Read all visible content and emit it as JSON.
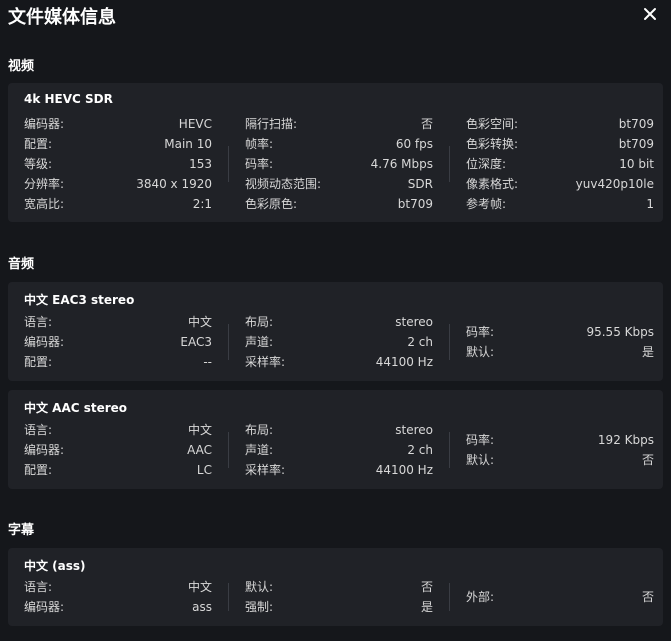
{
  "dialog": {
    "title": "文件媒体信息"
  },
  "video": {
    "section_title": "视频",
    "card": {
      "title": "4k HEVC SDR",
      "col1": [
        {
          "k": "编码器:",
          "v": "HEVC"
        },
        {
          "k": "配置:",
          "v": "Main 10"
        },
        {
          "k": "等级:",
          "v": "153"
        },
        {
          "k": "分辨率:",
          "v": "3840 x 1920"
        },
        {
          "k": "宽高比:",
          "v": "2:1"
        }
      ],
      "col2": [
        {
          "k": "隔行扫描:",
          "v": "否"
        },
        {
          "k": "帧率:",
          "v": "60 fps"
        },
        {
          "k": "码率:",
          "v": "4.76 Mbps"
        },
        {
          "k": "视频动态范围:",
          "v": "SDR"
        },
        {
          "k": "色彩原色:",
          "v": "bt709"
        }
      ],
      "col3": [
        {
          "k": "色彩空间:",
          "v": "bt709"
        },
        {
          "k": "色彩转换:",
          "v": "bt709"
        },
        {
          "k": "位深度:",
          "v": "10 bit"
        },
        {
          "k": "像素格式:",
          "v": "yuv420p10le"
        },
        {
          "k": "参考帧:",
          "v": "1"
        }
      ]
    }
  },
  "audio": {
    "section_title": "音频",
    "cards": [
      {
        "title": "中文 EAC3 stereo",
        "col1": [
          {
            "k": "语言:",
            "v": "中文"
          },
          {
            "k": "编码器:",
            "v": "EAC3"
          },
          {
            "k": "配置:",
            "v": "--"
          }
        ],
        "col2": [
          {
            "k": "布局:",
            "v": "stereo"
          },
          {
            "k": "声道:",
            "v": "2 ch"
          },
          {
            "k": "采样率:",
            "v": "44100 Hz"
          }
        ],
        "col3": [
          {
            "k": "码率:",
            "v": "95.55 Kbps"
          },
          {
            "k": "默认:",
            "v": "是"
          }
        ]
      },
      {
        "title": "中文 AAC stereo",
        "col1": [
          {
            "k": "语言:",
            "v": "中文"
          },
          {
            "k": "编码器:",
            "v": "AAC"
          },
          {
            "k": "配置:",
            "v": "LC"
          }
        ],
        "col2": [
          {
            "k": "布局:",
            "v": "stereo"
          },
          {
            "k": "声道:",
            "v": "2 ch"
          },
          {
            "k": "采样率:",
            "v": "44100 Hz"
          }
        ],
        "col3": [
          {
            "k": "码率:",
            "v": "192 Kbps"
          },
          {
            "k": "默认:",
            "v": "否"
          }
        ]
      }
    ]
  },
  "subtitle": {
    "section_title": "字幕",
    "card": {
      "title": "中文  (ass)",
      "col1": [
        {
          "k": "语言:",
          "v": "中文"
        },
        {
          "k": "编码器:",
          "v": "ass"
        }
      ],
      "col2": [
        {
          "k": "默认:",
          "v": "否"
        },
        {
          "k": "强制:",
          "v": "是"
        }
      ],
      "col3": [
        {
          "k": "外部:",
          "v": "否"
        }
      ]
    }
  }
}
